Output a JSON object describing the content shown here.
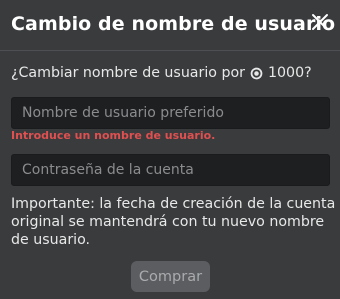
{
  "modal": {
    "title": "Cambio de nombre de usuario",
    "close_icon": "close-icon",
    "prompt_prefix": "¿Cambiar nombre de usuario por",
    "currency_icon": "robux-icon",
    "price": "1000?",
    "username_field": {
      "value": "",
      "placeholder": "Nombre de usuario preferido"
    },
    "username_error": "Introduce un nombre de usuario.",
    "password_field": {
      "value": "",
      "placeholder": "Contraseña de la cuenta"
    },
    "info": "Importante: la fecha de creación de la cuenta original se mantendrá con tu nuevo nombre de usuario.",
    "buy_label": "Comprar"
  },
  "colors": {
    "background": "#393b3d",
    "input_background": "#1e1f21",
    "error": "#e05050",
    "button_disabled": "#5b5d60",
    "button_text_disabled": "#a9abad"
  }
}
